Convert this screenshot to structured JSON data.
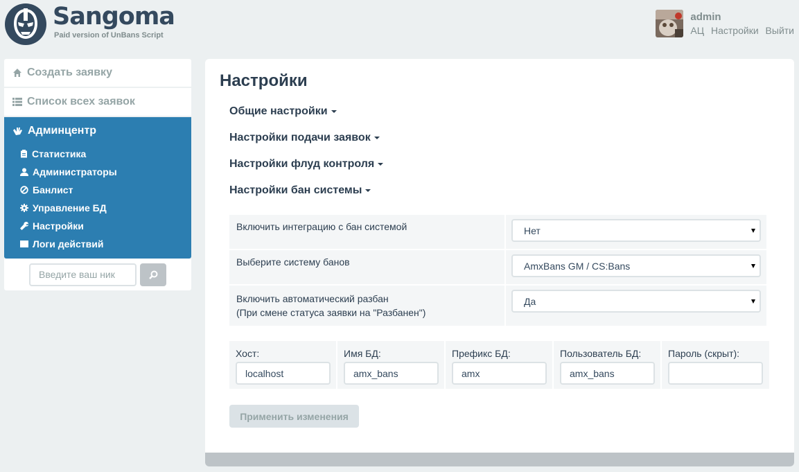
{
  "header": {
    "brand": "Sangoma",
    "tagline": "Paid version of UnBans Script",
    "user": {
      "name": "admin",
      "links": [
        "АЦ",
        "Настройки",
        "Выйти"
      ]
    }
  },
  "sidebar": {
    "items": [
      {
        "label": "Создать заявку",
        "icon": "home-icon"
      },
      {
        "label": "Список всех заявок",
        "icon": "list-icon"
      }
    ],
    "admin": {
      "label": "Админцентр",
      "icon": "hand-icon",
      "items": [
        {
          "label": "Статистика",
          "icon": "clipboard-icon"
        },
        {
          "label": "Администраторы",
          "icon": "user-icon"
        },
        {
          "label": "Банлист",
          "icon": "ban-icon"
        },
        {
          "label": "Управление БД",
          "icon": "gear-icon"
        },
        {
          "label": "Настройки",
          "icon": "wrench-icon"
        },
        {
          "label": "Логи действий",
          "icon": "log-icon"
        }
      ]
    },
    "search": {
      "placeholder": "Введите ваш ник",
      "icon": "search-icon"
    }
  },
  "main": {
    "title": "Настройки",
    "sections": [
      "Общие настройки",
      "Настройки подачи заявок",
      "Настройки флуд контроля",
      "Настройки бан системы"
    ],
    "ban_settings": [
      {
        "label": "Включить интеграцию с бан системой",
        "label2": "",
        "value": "Нет"
      },
      {
        "label": "Выберите систему банов",
        "label2": "",
        "value": "AmxBans GM / CS:Bans"
      },
      {
        "label": "Включить автоматический разбан",
        "label2": "(При смене статуса заявки на \"Разбанен\")",
        "value": "Да"
      }
    ],
    "db_fields": [
      {
        "label": "Хост:",
        "value": "localhost"
      },
      {
        "label": "Имя БД:",
        "value": "amx_bans"
      },
      {
        "label": "Префикс БД:",
        "value": "amx"
      },
      {
        "label": "Пользователь БД:",
        "value": "amx_bans"
      },
      {
        "label": "Пароль (скрыт):",
        "value": ""
      }
    ],
    "apply_label": "Применить изменения"
  }
}
